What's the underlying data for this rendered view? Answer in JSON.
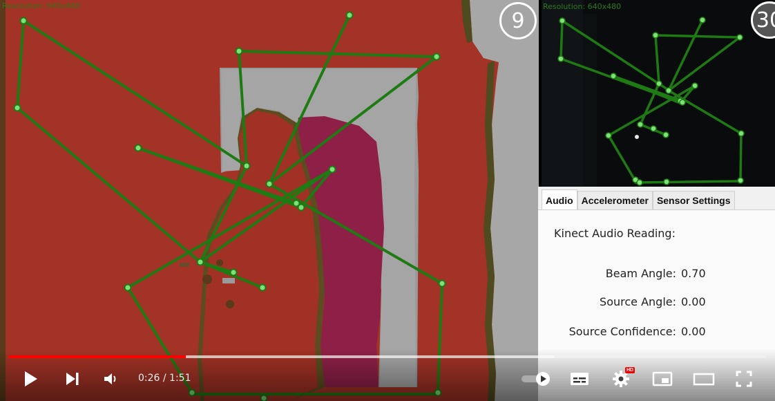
{
  "depth_view": {
    "resolution_label": "Resolution: 640x480",
    "fps": "9"
  },
  "color_view": {
    "resolution_label": "Resolution: 640x480",
    "fps": "30"
  },
  "tabs": [
    {
      "label": "Audio",
      "active": true
    },
    {
      "label": "Accelerometer",
      "active": false
    },
    {
      "label": "Sensor Settings",
      "active": false
    }
  ],
  "audio": {
    "title": "Kinect Audio Reading:",
    "beam_angle_label": "Beam Angle:",
    "beam_angle_value": "0.70",
    "source_angle_label": "Source Angle:",
    "source_angle_value": "0.00",
    "source_confidence_label": "Source Confidence:",
    "source_confidence_value": "0.00"
  },
  "player": {
    "time": "0:26 / 1:51",
    "played_fraction": 0.234,
    "buffered_fraction": 0.72,
    "hd_badge": "HD",
    "icons": [
      "play-icon",
      "next-icon",
      "volume-icon",
      "autoplay-toggle-icon",
      "subtitles-icon",
      "settings-icon",
      "miniplayer-icon",
      "theater-mode-icon",
      "fullscreen-icon"
    ]
  },
  "colors": {
    "depth_background": "#a33326",
    "skeleton": "#1e7a12",
    "joint": "#7fe07a",
    "progress_played": "#ff0000"
  }
}
